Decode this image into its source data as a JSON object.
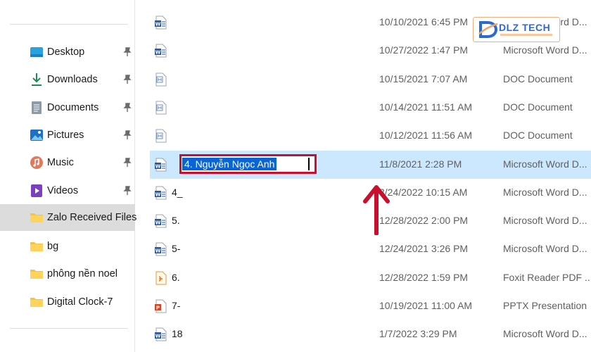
{
  "sidebar": {
    "items": [
      {
        "label": "Desktop",
        "icon": "desktop-icon",
        "pinned": true
      },
      {
        "label": "Downloads",
        "icon": "download-icon",
        "pinned": true
      },
      {
        "label": "Documents",
        "icon": "document-icon",
        "pinned": true
      },
      {
        "label": "Pictures",
        "icon": "pictures-icon",
        "pinned": true
      },
      {
        "label": "Music",
        "icon": "music-icon",
        "pinned": true
      },
      {
        "label": "Videos",
        "icon": "videos-icon",
        "pinned": true
      },
      {
        "label": "Zalo Received Files",
        "icon": "folder-icon",
        "pinned": false,
        "selected": true
      },
      {
        "label": "bg",
        "icon": "folder-icon",
        "pinned": false
      },
      {
        "label": "phông nền noel",
        "icon": "folder-icon",
        "pinned": false
      },
      {
        "label": "Digital Clock-7",
        "icon": "folder-icon",
        "pinned": false
      }
    ]
  },
  "files": [
    {
      "name": "",
      "date": "10/10/2021 6:45 PM",
      "type": "Microsoft Word D...",
      "icon": "word-icon"
    },
    {
      "name": "",
      "date": "10/27/2022 1:47 PM",
      "type": "Microsoft Word D...",
      "icon": "word-icon"
    },
    {
      "name": "",
      "date": "10/15/2021 7:07 AM",
      "type": "DOC Document",
      "icon": "doc-icon"
    },
    {
      "name": "",
      "date": "10/14/2021 11:51 AM",
      "type": "DOC Document",
      "icon": "doc-icon"
    },
    {
      "name": "",
      "date": "10/12/2021 11:56 AM",
      "type": "DOC Document",
      "icon": "doc-icon"
    },
    {
      "name": "4. Nguyễn Ngọc Anh",
      "date": "11/8/2021 2:28 PM",
      "type": "Microsoft Word D...",
      "icon": "word-icon",
      "renaming": true
    },
    {
      "name": "4_",
      "date": "3/24/2022 10:15 AM",
      "type": "Microsoft Word D...",
      "icon": "word-icon"
    },
    {
      "name": "5.",
      "date": "12/28/2022 2:00 PM",
      "type": "Microsoft Word D...",
      "icon": "word-icon"
    },
    {
      "name": "5-",
      "date": "12/24/2021 3:26 PM",
      "type": "Microsoft Word D...",
      "icon": "word-icon"
    },
    {
      "name": "6.",
      "date": "12/28/2022 1:59 PM",
      "type": "Foxit Reader PDF ...",
      "icon": "pdf-icon"
    },
    {
      "name": "7-",
      "date": "10/19/2021 11:00 AM",
      "type": "PPTX Presentation",
      "icon": "pptx-icon"
    },
    {
      "name": "18",
      "date": "1/7/2022 3:29 PM",
      "type": "Microsoft Word D...",
      "icon": "word-icon"
    }
  ],
  "rename_value": "4. Nguyễn Ngọc Anh",
  "logo": {
    "text": "DLZ TECH"
  },
  "colors": {
    "selection_row": "#cce8ff",
    "rename_highlight": "#0a64d4",
    "annotation_red": "#c8102e",
    "sidebar_selected": "#dcdcdc",
    "logo_blue": "#2a6bd0"
  }
}
